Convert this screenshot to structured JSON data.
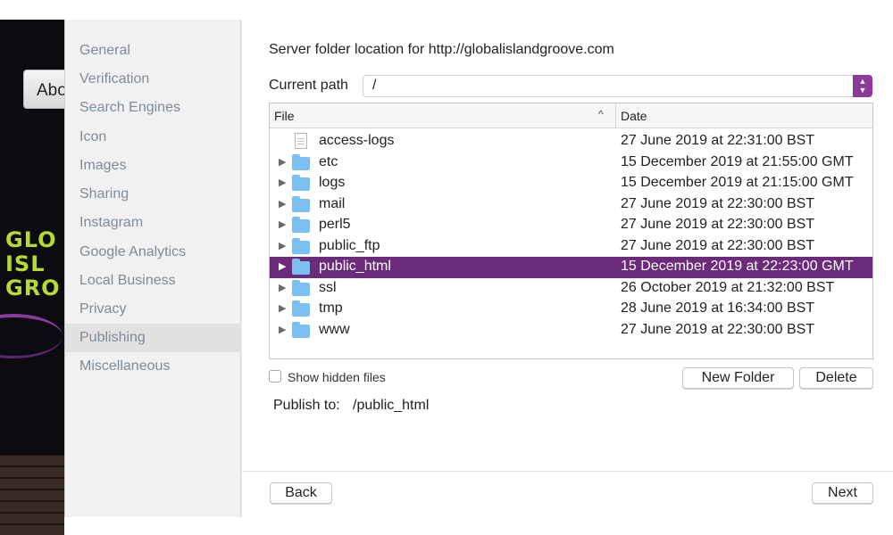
{
  "background_app": {
    "tab_label": "Abo",
    "logo_lines": [
      "GLO",
      "ISL",
      "GRO"
    ]
  },
  "sidebar": {
    "items": [
      {
        "label": "General"
      },
      {
        "label": "Verification"
      },
      {
        "label": "Search Engines"
      },
      {
        "label": "Icon"
      },
      {
        "label": "Images"
      },
      {
        "label": "Sharing"
      },
      {
        "label": "Instagram"
      },
      {
        "label": "Google Analytics"
      },
      {
        "label": "Local Business"
      },
      {
        "label": "Privacy"
      },
      {
        "label": "Publishing"
      },
      {
        "label": "Miscellaneous"
      }
    ],
    "selected": "Publishing"
  },
  "main": {
    "heading": "Server folder location for http://globalislandgroove.com",
    "current_path_label": "Current path",
    "current_path_value": "/",
    "columns": {
      "file": "File",
      "date": "Date"
    },
    "rows": [
      {
        "name": "access-logs",
        "date": "27 June 2019 at 22:31:00 BST",
        "kind": "file"
      },
      {
        "name": "etc",
        "date": "15 December 2019 at 21:55:00 GMT",
        "kind": "folder"
      },
      {
        "name": "logs",
        "date": "15 December 2019 at 21:15:00 GMT",
        "kind": "folder"
      },
      {
        "name": "mail",
        "date": "27 June 2019 at 22:30:00 BST",
        "kind": "folder"
      },
      {
        "name": "perl5",
        "date": "27 June 2019 at 22:30:00 BST",
        "kind": "folder"
      },
      {
        "name": "public_ftp",
        "date": "27 June 2019 at 22:30:00 BST",
        "kind": "folder"
      },
      {
        "name": "public_html",
        "date": "15 December 2019 at 22:23:00 GMT",
        "kind": "folder",
        "selected": true
      },
      {
        "name": "ssl",
        "date": "26 October 2019 at 21:32:00 BST",
        "kind": "folder"
      },
      {
        "name": "tmp",
        "date": "28 June 2019 at 16:34:00 BST",
        "kind": "folder"
      },
      {
        "name": "www",
        "date": "27 June 2019 at 22:30:00 BST",
        "kind": "folder"
      }
    ],
    "show_hidden_label": "Show hidden files",
    "show_hidden_checked": false,
    "new_folder_label": "New Folder",
    "delete_label": "Delete",
    "publish_to_label": "Publish to:",
    "publish_to_value": "/public_html",
    "back_label": "Back",
    "next_label": "Next"
  },
  "colors": {
    "accent": "#6b2a7a",
    "folder": "#7cc0f3",
    "sidebar_text": "#7f8c99"
  }
}
